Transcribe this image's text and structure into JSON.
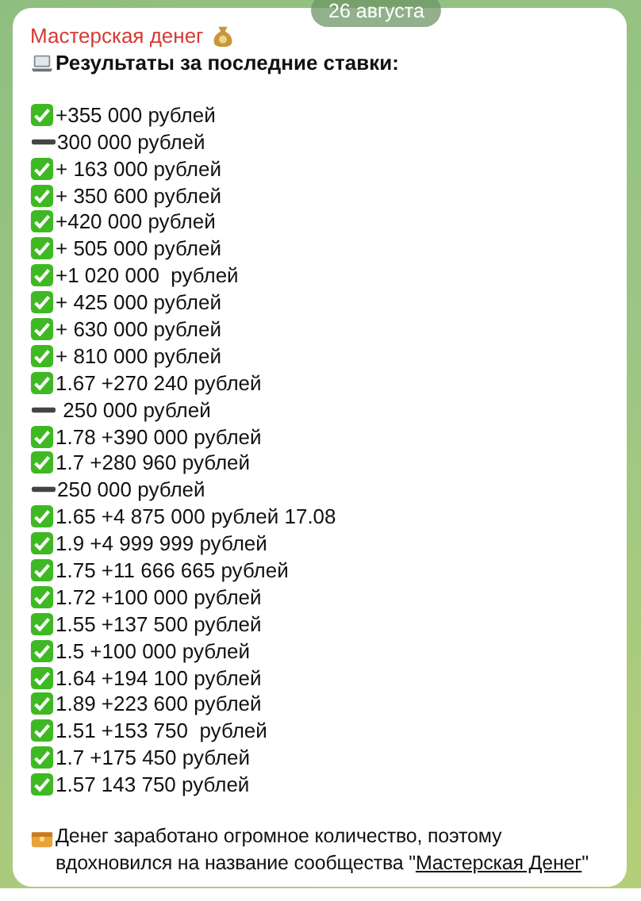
{
  "date_badge": "26 августа",
  "message": {
    "sender": "Мастерская денег",
    "header": "Результаты за последние ставки:",
    "results": [
      {
        "kind": "win",
        "text": "+355 000 рублей"
      },
      {
        "kind": "push",
        "text": "300 000 рублей"
      },
      {
        "kind": "win",
        "text": "+ 163 000 рублей"
      },
      {
        "kind": "win",
        "text": "+ 350 600 рублей"
      },
      {
        "kind": "win",
        "text": "+420 000 рублей"
      },
      {
        "kind": "win",
        "text": "+ 505 000 рублей"
      },
      {
        "kind": "win",
        "text": "+1 020 000  рублей"
      },
      {
        "kind": "win",
        "text": "+ 425 000 рублей"
      },
      {
        "kind": "win",
        "text": "+ 630 000 рублей"
      },
      {
        "kind": "win",
        "text": "+ 810 000 рублей"
      },
      {
        "kind": "win",
        "text": "1.67 +270 240 рублей"
      },
      {
        "kind": "push",
        "text": " 250 000 рублей"
      },
      {
        "kind": "win",
        "text": "1.78 +390 000 рублей"
      },
      {
        "kind": "win",
        "text": "1.7 +280 960 рублей"
      },
      {
        "kind": "push",
        "text": "250 000 рублей"
      },
      {
        "kind": "win",
        "text": "1.65 +4 875 000 рублей 17.08"
      },
      {
        "kind": "win",
        "text": "1.9 +4 999 999 рублей"
      },
      {
        "kind": "win",
        "text": "1.75 +11 666 665 рублей"
      },
      {
        "kind": "win",
        "text": "1.72 +100 000 рублей"
      },
      {
        "kind": "win",
        "text": "1.55 +137 500 рублей"
      },
      {
        "kind": "win",
        "text": "1.5 +100 000 рублей"
      },
      {
        "kind": "win",
        "text": "1.64 +194 100 рублей"
      },
      {
        "kind": "win",
        "text": "1.89 +223 600 рублей"
      },
      {
        "kind": "win",
        "text": "1.51 +153 750  рублей"
      },
      {
        "kind": "win",
        "text": "1.7 +175 450 рублей"
      },
      {
        "kind": "win",
        "text": "1.57 143 750 рублей"
      }
    ],
    "footer": {
      "text": "Денег заработано огромное количество, поэтому вдохновился на название сообщества \"",
      "link": "Мастерская Денег",
      "text_after": "\""
    }
  }
}
